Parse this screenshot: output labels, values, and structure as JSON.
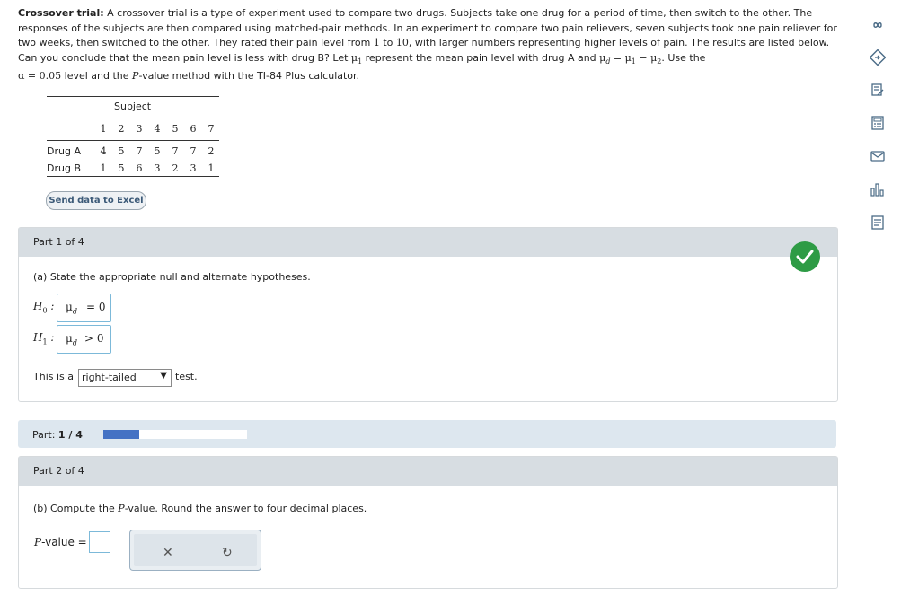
{
  "problem": {
    "title": "Crossover trial:",
    "text1": " A crossover trial is a type of experiment used to compare two drugs. Subjects take one drug for a period of time, then switch to the other. The responses of the subjects are then compared using matched-pair methods. In an experiment to compare two pain relievers, seven subjects took one pain reliever for two weeks, then switched to the other. They rated their pain level from ",
    "num1": "1",
    "text2": " to ",
    "num10": "10",
    "text3": ", with larger numbers representing higher levels of pain. The results are listed below. Can you conclude that the mean pain level is less with drug B? Let ",
    "text4": " represent the mean pain level with drug A and ",
    "text5": ". Use the",
    "alpha_text": "α = 0.05",
    "text6": " level and the ",
    "pvalue_word": "P",
    "text7": "-value method with the TI-84 Plus calculator."
  },
  "table": {
    "header": "Subject",
    "subjects": [
      "1",
      "2",
      "3",
      "4",
      "5",
      "6",
      "7"
    ],
    "rows": [
      {
        "label": "Drug A",
        "values": [
          "4",
          "5",
          "7",
          "5",
          "7",
          "7",
          "2"
        ]
      },
      {
        "label": "Drug B",
        "values": [
          "1",
          "5",
          "6",
          "3",
          "2",
          "3",
          "1"
        ]
      }
    ]
  },
  "excel_button": "Send data to Excel",
  "part1": {
    "header": "Part 1 of 4",
    "question": "(a) State the appropriate null and alternate hypotheses.",
    "h0": {
      "sign": "= 0"
    },
    "h1": {
      "sign": "> 0"
    },
    "test_prefix": "This is a",
    "test_value": "right-tailed",
    "test_suffix": "test."
  },
  "progress": {
    "label_prefix": "Part: ",
    "label_value": "1 / 4",
    "fraction": 0.25,
    "color": "#4472c4"
  },
  "part2": {
    "header": "Part 2 of 4",
    "question_prefix": "(b) Compute the ",
    "question_p": "P",
    "question_suffix": "-value. Round the answer to four decimal places.",
    "pvalue_label": "-value ="
  },
  "sidebar": [
    "infinity-icon",
    "answer-key-icon",
    "edit-icon",
    "calculator-icon",
    "mail-icon",
    "chart-icon",
    "data-icon"
  ]
}
